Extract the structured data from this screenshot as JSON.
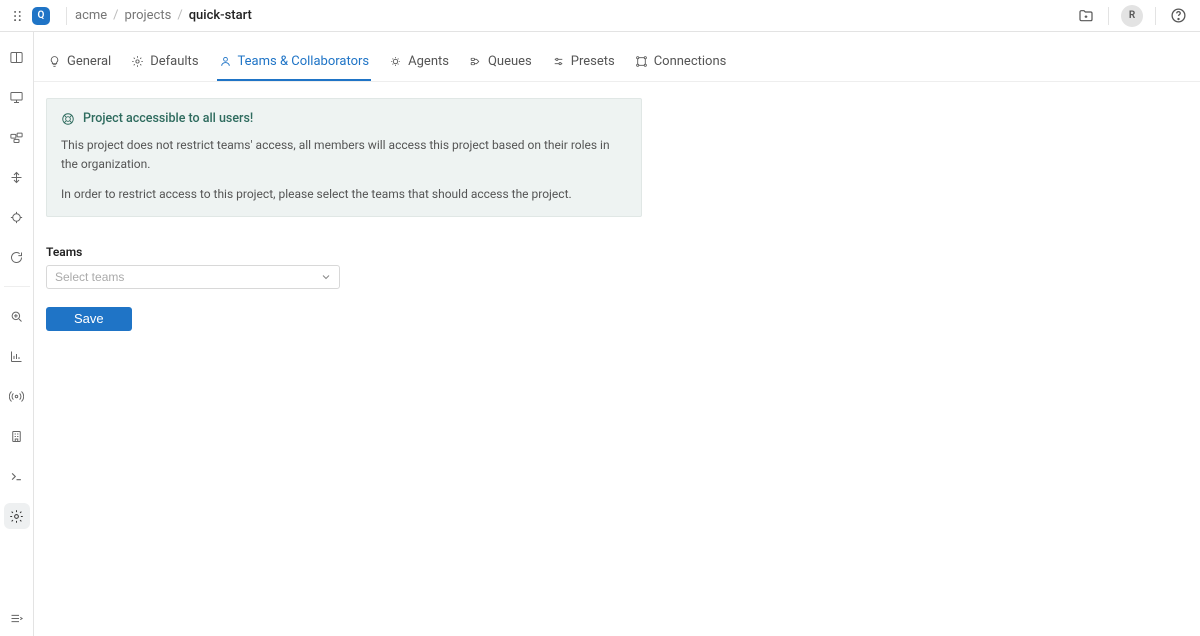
{
  "header": {
    "org_initial": "Q",
    "user_initial": "R",
    "breadcrumbs": [
      "acme",
      "projects",
      "quick-start"
    ]
  },
  "tabs": [
    {
      "id": "general",
      "label": "General"
    },
    {
      "id": "defaults",
      "label": "Defaults"
    },
    {
      "id": "teams",
      "label": "Teams & Collaborators",
      "active": true
    },
    {
      "id": "agents",
      "label": "Agents"
    },
    {
      "id": "queues",
      "label": "Queues"
    },
    {
      "id": "presets",
      "label": "Presets"
    },
    {
      "id": "connections",
      "label": "Connections"
    }
  ],
  "alert": {
    "title": "Project accessible to all users!",
    "line1": "This project does not restrict teams' access, all members will access this project based on their roles in the organization.",
    "line2": "In order to restrict access to this project, please select the teams that should access the project."
  },
  "form": {
    "teams_label": "Teams",
    "teams_placeholder": "Select teams",
    "save_label": "Save"
  }
}
